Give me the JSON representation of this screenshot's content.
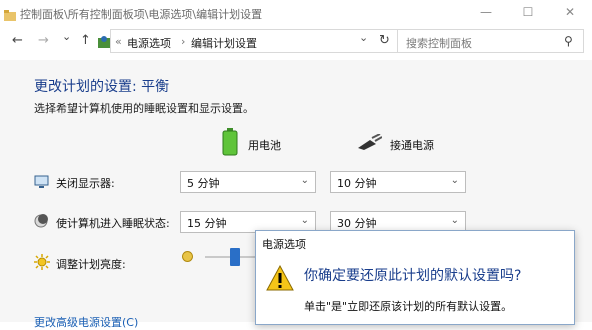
{
  "window": {
    "title": "控制面板\\所有控制面板项\\电源选项\\编辑计划设置",
    "minimize_glyph": "—",
    "maximize_glyph": "☐",
    "close_glyph": "✕"
  },
  "nav": {
    "back_glyph": "←",
    "forward_glyph": "→",
    "dropdown_glyph": "⌄",
    "up_glyph": "↑",
    "breadcrumb_sep": "«",
    "breadcrumb": [
      "电源选项",
      "编辑计划设置"
    ],
    "breadcrumb_arrow": "›",
    "address_dropdown_glyph": "⌄",
    "refresh_glyph": "↻",
    "search_placeholder": "搜索控制面板",
    "search_glyph": "⚲"
  },
  "page": {
    "heading": "更改计划的设置: 平衡",
    "subtext": "选择希望计算机使用的睡眠设置和显示设置。",
    "col_battery": "用电池",
    "col_plugged": "接通电源",
    "rows": [
      {
        "label": "关闭显示器:",
        "battery": "5 分钟",
        "plugged": "10 分钟"
      },
      {
        "label": "使计算机进入睡眠状态:",
        "battery": "15 分钟",
        "plugged": "30 分钟"
      },
      {
        "label": "调整计划亮度:"
      }
    ],
    "brightness_level": 0.3,
    "link_partial": "更改高级电源设置(C)"
  },
  "dialog": {
    "title": "电源选项",
    "question": "你确定要还原此计划的默认设置吗?",
    "detail": "单击\"是\"立即还原该计划的所有默认设置。",
    "warn_glyph": "!"
  },
  "colors": {
    "heading": "#1a3e8c",
    "accent": "#2a6fc7",
    "warning": "#f5c518"
  }
}
